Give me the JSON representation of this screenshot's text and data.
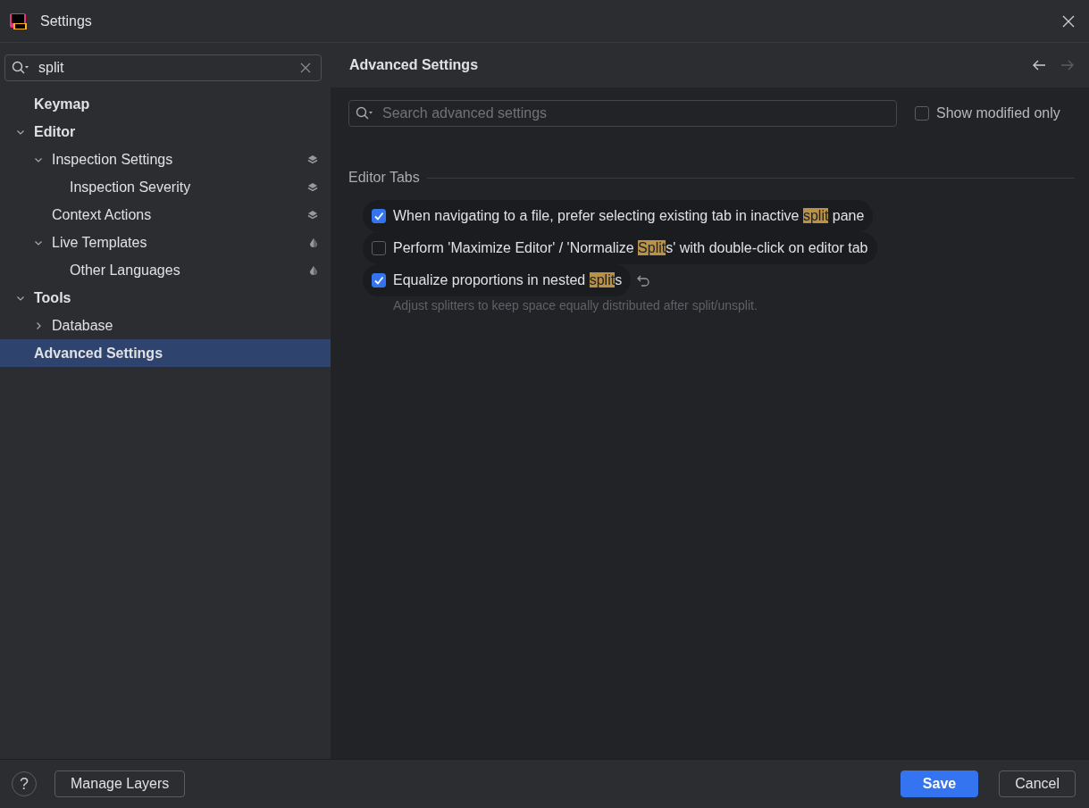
{
  "window": {
    "title": "Settings"
  },
  "sidebar": {
    "search": {
      "value": "split"
    },
    "tree": [
      {
        "label": "Keymap",
        "selected": false
      },
      {
        "label": "Editor",
        "selected": false,
        "expanded": true,
        "children": [
          {
            "label": "Inspection Settings",
            "selected": false,
            "expanded": true,
            "kind": "layers",
            "children": [
              {
                "label": "Inspection Severity",
                "selected": false,
                "kind": "layers"
              }
            ]
          },
          {
            "label": "Context Actions",
            "selected": false,
            "kind": "layers"
          },
          {
            "label": "Live Templates",
            "selected": false,
            "expanded": true,
            "kind": "drop",
            "children": [
              {
                "label": "Other Languages",
                "selected": false,
                "kind": "drop"
              }
            ]
          }
        ]
      },
      {
        "label": "Tools",
        "selected": false,
        "expanded": true,
        "children": [
          {
            "label": "Database",
            "selected": false,
            "expanded": false
          }
        ]
      },
      {
        "label": "Advanced Settings",
        "selected": true
      }
    ]
  },
  "content": {
    "title": "Advanced Settings",
    "nav": [
      {
        "kind": "back",
        "disabled": false
      },
      {
        "kind": "forward",
        "disabled": true
      }
    ],
    "search": {
      "placeholder": "Search advanced settings"
    },
    "show_modified_only": {
      "label": "Show modified only",
      "checked": false
    },
    "group": {
      "title": "Editor Tabs",
      "options": [
        {
          "checked": true,
          "modified": false,
          "segments": [
            {
              "text": "When navigating to a file, prefer selecting existing tab in inactive ",
              "match": false
            },
            {
              "text": "split",
              "match": true
            },
            {
              "text": " pane",
              "match": false
            }
          ]
        },
        {
          "checked": false,
          "modified": false,
          "segments": [
            {
              "text": "Perform 'Maximize Editor' / 'Normalize ",
              "match": false
            },
            {
              "text": "Split",
              "match": true
            },
            {
              "text": "s' with double-click on editor tab",
              "match": false
            }
          ]
        },
        {
          "checked": true,
          "modified": true,
          "segments": [
            {
              "text": "Equalize proportions in nested ",
              "match": false
            },
            {
              "text": "split",
              "match": true
            },
            {
              "text": "s",
              "match": false
            }
          ],
          "description": "Adjust splitters to keep space equally distributed after split/unsplit."
        }
      ]
    }
  },
  "footer": {
    "help": "?",
    "buttons": [
      {
        "label": "Manage Layers",
        "kind": "plain"
      },
      {
        "label": "Save",
        "kind": "primary"
      },
      {
        "label": "Cancel",
        "kind": "plain"
      }
    ]
  }
}
